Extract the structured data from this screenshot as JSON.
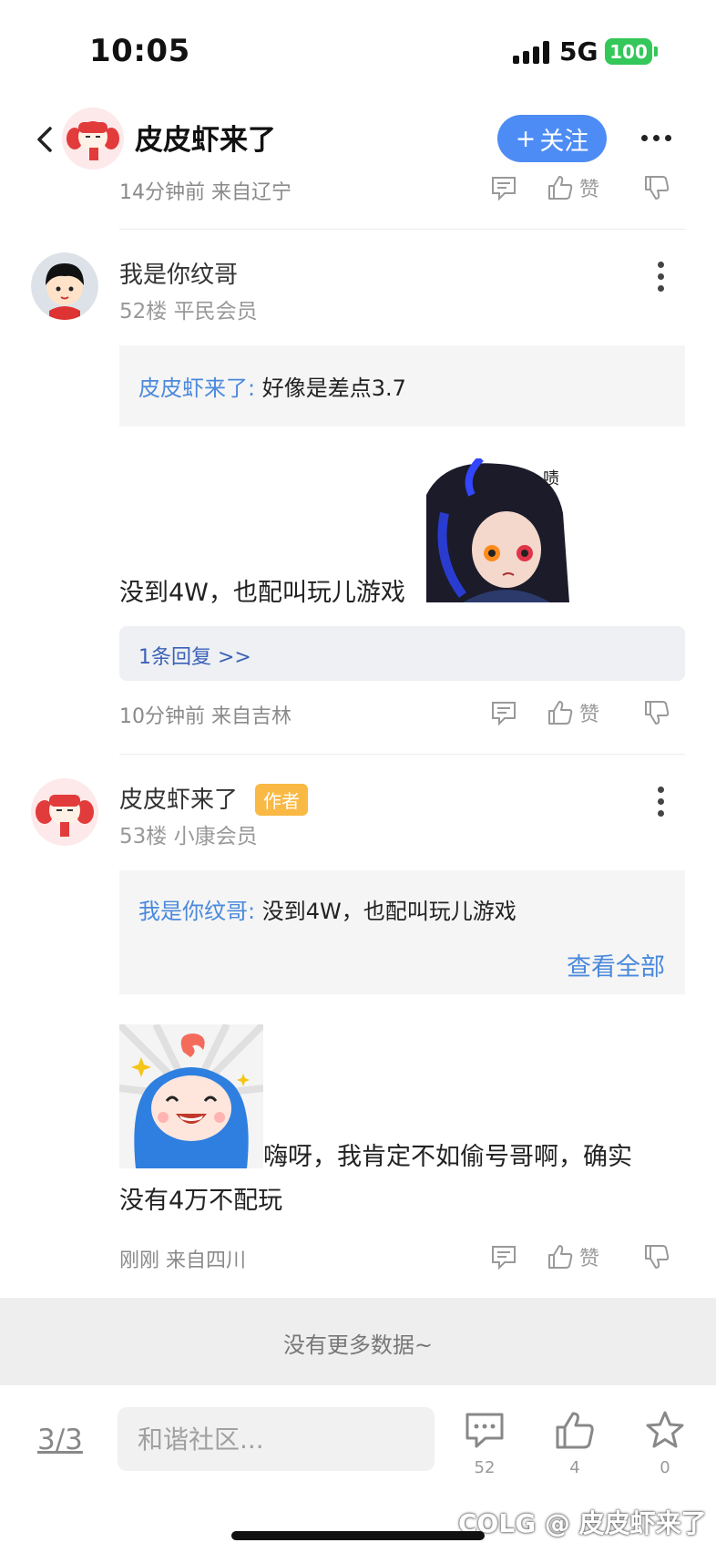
{
  "status_bar": {
    "time": "10:05",
    "network": "5G",
    "battery": "100"
  },
  "header": {
    "title": "皮皮虾来了",
    "follow_label": "关注",
    "follow_plus": "+"
  },
  "posts": [
    {
      "meta": "14分钟前 来自辽宁",
      "like_label": "赞"
    },
    {
      "username": "我是你纹哥",
      "floor": "52楼 平民会员",
      "quote_name": "皮皮虾来了:",
      "quote_text": "好像是差点3.7",
      "body": "没到4W，也配叫玩儿游戏",
      "sticker_text": "啧",
      "replies_link": "1条回复 >>",
      "meta": "10分钟前 来自吉林",
      "like_label": "赞"
    },
    {
      "username": "皮皮虾来了",
      "badge": "作者",
      "floor": "53楼 小康会员",
      "quote_name": "我是你纹哥:",
      "quote_text": "没到4W，也配叫玩儿游戏",
      "see_all": "查看全部",
      "body_line1": "嗨呀，我肯定不如偷号哥啊，确实",
      "body_line2": "没有4万不配玩",
      "meta": "刚刚 来自四川",
      "like_label": "赞"
    }
  ],
  "no_more": "没有更多数据~",
  "bottom_bar": {
    "page": "3/3",
    "input_placeholder": "和谐社区...",
    "comment_count": "52",
    "like_count": "4",
    "favorite_count": "0"
  },
  "watermark": "COLG @ 皮皮虾来了",
  "colors": {
    "accent": "#4d8cf5",
    "link": "#4a89dc",
    "badge": "#f9b944",
    "battery": "#34c759"
  },
  "icons": [
    "back-icon",
    "more-icon",
    "comment-icon",
    "thumbs-up-icon",
    "thumbs-down-icon",
    "star-icon"
  ]
}
